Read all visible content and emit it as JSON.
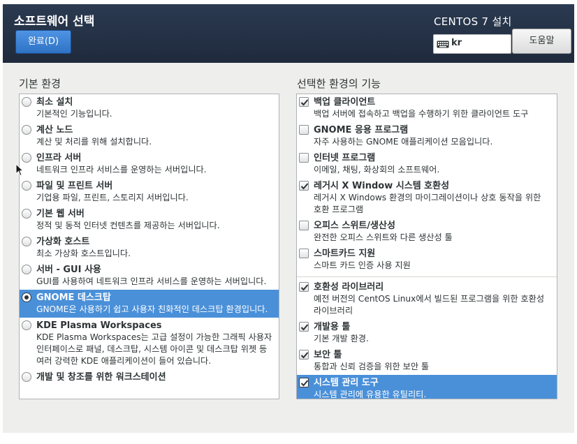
{
  "header": {
    "spoke_title": "소프트웨어 선택",
    "done_label": "완료(D)",
    "install_title": "CENTOS 7 설치",
    "keyboard_layout": "kr",
    "help_label": "도움말"
  },
  "base_env": {
    "label": "기본 환경",
    "selected_index": 7,
    "items": [
      {
        "title": "최소 설치",
        "desc": "기본적인 기능입니다."
      },
      {
        "title": "계산 노드",
        "desc": "계산 및 처리를 위해 설치합니다."
      },
      {
        "title": "인프라 서버",
        "desc": "네트워크 인프라 서비스를 운영하는 서버입니다."
      },
      {
        "title": "파일 및 프린트 서버",
        "desc": "기업용 파일, 프린트, 스토리지 서버입니다."
      },
      {
        "title": "기본 웹 서버",
        "desc": "정적 및 동적 인터넷 컨텐츠를 제공하는 서버입니다."
      },
      {
        "title": "가상화 호스트",
        "desc": "최소 가상화 호스트입니다."
      },
      {
        "title": "서버 - GUI 사용",
        "desc": "GUI를 사용하여 네트워크 인프라 서비스를 운영하는 서버입니다."
      },
      {
        "title": "GNOME 데스크탑",
        "desc": "GNOME은 사용하기 쉽고 사용자 친화적인 데스크탑 환경입니다."
      },
      {
        "title": "KDE Plasma Workspaces",
        "desc": "KDE Plasma Workspaces는 고급 설정이 가능한 그래픽 사용자 인터페이스로 패널, 데스크탑, 시스템 아이콘 및 데스크탑 위젯 등 여러 강력한 KDE 애플리케이션이 들어 있습니다."
      },
      {
        "title": "개발 및 창조를 위한 워크스테이션",
        "desc": ""
      }
    ]
  },
  "addons": {
    "label": "선택한 환경의 기능",
    "items": [
      {
        "title": "백업 클라이언트",
        "desc": "백업 서버에 접속하고 백업을 수행하기 위한 클라이언트 도구",
        "checked": true,
        "selected": false,
        "group": 1
      },
      {
        "title": "GNOME 응용 프로그램",
        "desc": "자주 사용하는 GNOME 애플리케이션 모음입니다.",
        "checked": false,
        "selected": false,
        "group": 1
      },
      {
        "title": "인터넷 프로그램",
        "desc": "이메일, 채팅, 화상회의 소프트웨어.",
        "checked": false,
        "selected": false,
        "group": 1
      },
      {
        "title": "레거시 X Window 시스템 호환성",
        "desc": "레거시 X Windows 환경의 마이그레이션이나 상호 동작을 위한 호환 프로그램",
        "checked": true,
        "selected": false,
        "group": 1
      },
      {
        "title": "오피스 스위트/생산성",
        "desc": "완전한 오피스 스위트와 다른 생산성 툴",
        "checked": false,
        "selected": false,
        "group": 1
      },
      {
        "title": "스마트카드 지원",
        "desc": "스마트 카드 인증 사용 지원",
        "checked": false,
        "selected": false,
        "group": 1
      },
      {
        "title": "호환성 라이브러리",
        "desc": "예전 버전의 CentOS Linux에서 빌드된 프로그램을 위한 호환성 라이브러리",
        "checked": true,
        "selected": false,
        "group": 2
      },
      {
        "title": "개발용 툴",
        "desc": "기본 개발 환경.",
        "checked": true,
        "selected": false,
        "group": 2
      },
      {
        "title": "보안 툴",
        "desc": "통합과 신뢰 검증을 위한 보안 툴",
        "checked": true,
        "selected": false,
        "group": 2
      },
      {
        "title": "시스템 관리 도구",
        "desc": "시스템 관리에 유용한 유틸리티.",
        "checked": true,
        "selected": true,
        "group": 2
      }
    ]
  }
}
